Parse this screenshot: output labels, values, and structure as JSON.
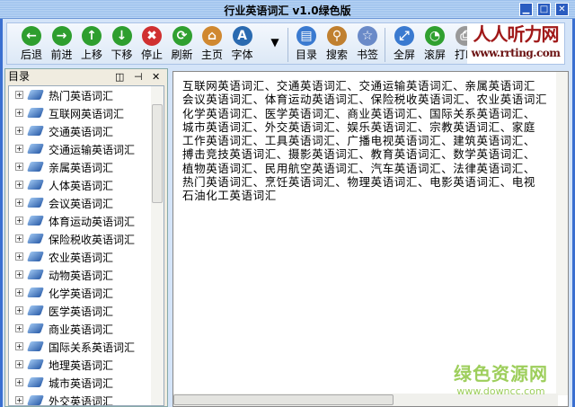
{
  "window": {
    "title": "行业英语词汇 v1.0绿色版",
    "min": "▁",
    "max": "□",
    "close": "✕"
  },
  "toolbar": {
    "buttons": [
      {
        "label": "后退",
        "icon": "arrow-left-icon",
        "glyph": "←",
        "color": "#2e9e2e"
      },
      {
        "label": "前进",
        "icon": "arrow-right-icon",
        "glyph": "→",
        "color": "#2e9e2e"
      },
      {
        "label": "上移",
        "icon": "arrow-up-icon",
        "glyph": "↑",
        "color": "#2e9e2e"
      },
      {
        "label": "下移",
        "icon": "arrow-down-icon",
        "glyph": "↓",
        "color": "#2e9e2e"
      },
      {
        "label": "停止",
        "icon": "stop-icon",
        "glyph": "✖",
        "color": "#d03030"
      },
      {
        "label": "刷新",
        "icon": "refresh-icon",
        "glyph": "⟳",
        "color": "#30a030"
      },
      {
        "label": "主页",
        "icon": "home-icon",
        "glyph": "⌂",
        "color": "#d08830"
      },
      {
        "label": "字体",
        "icon": "font-icon",
        "glyph": "A",
        "color": "#2a6ab0"
      }
    ],
    "dropdown": "▼",
    "buttons2": [
      {
        "label": "目录",
        "icon": "contents-icon",
        "glyph": "▤",
        "color": "#3a7ad0"
      },
      {
        "label": "搜索",
        "icon": "search-icon",
        "glyph": "⚲",
        "color": "#c08030"
      },
      {
        "label": "书签",
        "icon": "bookmark-star-icon",
        "glyph": "☆",
        "color": "#6a8ac8"
      }
    ],
    "buttons3": [
      {
        "label": "全屏",
        "icon": "fullscreen-icon",
        "glyph": "⤢",
        "color": "#3a7ad0"
      },
      {
        "label": "滚屏",
        "icon": "scroll-icon",
        "glyph": "◔",
        "color": "#30a030"
      },
      {
        "label": "打印",
        "icon": "print-icon",
        "glyph": "⎙",
        "color": "#999999"
      }
    ],
    "logo": {
      "cn": "人人听力网",
      "url": "www.rrting.com"
    }
  },
  "sidebar": {
    "title": "目录",
    "pin": "⊣",
    "dock": "◫",
    "close": "✕",
    "items": [
      "热门英语词汇",
      "互联网英语词汇",
      "交通英语词汇",
      "交通运输英语词汇",
      "亲属英语词汇",
      "人体英语词汇",
      "会议英语词汇",
      "体育运动英语词汇",
      "保险税收英语词汇",
      "农业英语词汇",
      "动物英语词汇",
      "化学英语词汇",
      "医学英语词汇",
      "商业英语词汇",
      "国际关系英语词汇",
      "地理英语词汇",
      "城市英语词汇",
      "外交英语词汇"
    ]
  },
  "content": {
    "lines": [
      "互联网英语词汇、交通英语词汇、交通运输英语词汇、亲属英语词汇",
      "会议英语词汇、体育运动英语词汇、保险税收英语词汇、农业英语词汇",
      "化学英语词汇、医学英语词汇、商业英语词汇、国际关系英语词汇、",
      "城市英语词汇、外交英语词汇、娱乐英语词汇、宗教英语词汇、家庭",
      "工作英语词汇、工具英语词汇、广播电视英语词汇、建筑英语词汇、",
      "搏击竞技英语词汇、摄影英语词汇、教育英语词汇、数学英语词汇、",
      "植物英语词汇、民用航空英语词汇、汽车英语词汇、法律英语词汇、",
      "热门英语词汇、烹饪英语词汇、物理英语词汇、电影英语词汇、电视",
      "石油化工英语词汇"
    ]
  },
  "watermark": {
    "cn": "绿色资源网",
    "url": "www.downcc.com"
  }
}
